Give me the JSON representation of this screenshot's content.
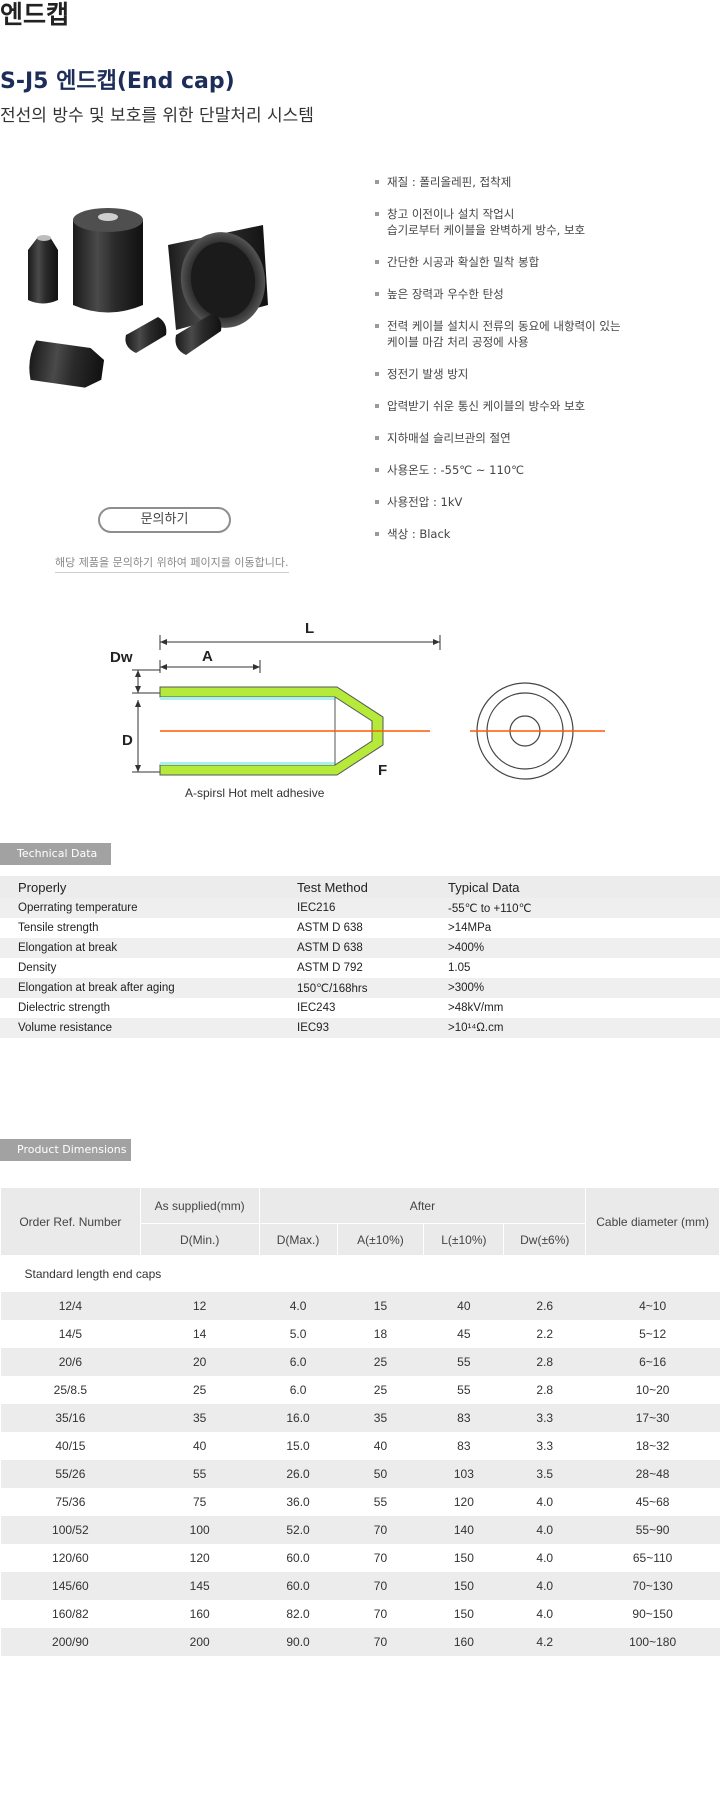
{
  "page_title": "엔드캡",
  "product": {
    "name": "S-J5 엔드캡(End cap)",
    "subtitle": "전선의 방수 및 보호를 위한 단말처리 시스템"
  },
  "inquiry": {
    "button_label": "문의하기",
    "note": "해당 제품을 문의하기 위하여 페이지를 이동합니다."
  },
  "features": [
    {
      "line1": "재질 : 폴리올레핀, 접착제",
      "line2": ""
    },
    {
      "line1": "창고 이전이나 설치 작업시",
      "line2": "습기로부터 케이블을 완벽하게 방수, 보호"
    },
    {
      "line1": "간단한 시공과 확실한 밀착 봉합",
      "line2": ""
    },
    {
      "line1": "높은 장력과 우수한 탄성",
      "line2": ""
    },
    {
      "line1": "전력 케이블 설치시 전류의 동요에 내항력이 있는",
      "line2": "케이블 마감 처리 공정에 사용"
    },
    {
      "line1": "정전기 발생 방지",
      "line2": ""
    },
    {
      "line1": "압력받기 쉬운 통신 케이블의 방수와 보호",
      "line2": ""
    },
    {
      "line1": "지하매설 슬리브관의 절연",
      "line2": ""
    },
    {
      "line1": "사용온도 : -55℃ ~ 110℃",
      "line2": ""
    },
    {
      "line1": "사용전압 : 1kV",
      "line2": ""
    },
    {
      "line1": "색상 : Black",
      "line2": ""
    }
  ],
  "diagram": {
    "label_L": "L",
    "label_A": "A",
    "label_Dw": "Dw",
    "label_D": "D",
    "label_F": "F",
    "caption": "A-spirsl Hot melt adhesive",
    "colors": {
      "wall": "#b5ea3a",
      "axis": "#ff5a00",
      "adhesive": "#a9f1f0"
    }
  },
  "technical": {
    "tab_label": "Technical Data",
    "headers": [
      "Properly",
      "Test Method",
      "Typical Data"
    ],
    "rows": [
      [
        "Operrating temperature",
        "IEC216",
        "-55℃ to +110℃"
      ],
      [
        "Tensile strength",
        "ASTM D 638",
        ">14MPa"
      ],
      [
        "Elongation at break",
        "ASTM D 638",
        ">400%"
      ],
      [
        "Density",
        "ASTM D 792",
        "1.05"
      ],
      [
        "Elongation at break after aging",
        "150℃/168hrs",
        ">300%"
      ],
      [
        "Dielectric strength",
        "IEC243",
        ">48kV/mm"
      ],
      [
        "Volume resistance",
        "IEC93",
        ">10¹⁴Ω.cm"
      ]
    ]
  },
  "dimensions": {
    "tab_label": "Product Dimensions",
    "header": {
      "order": "Order Ref. Number",
      "supplied": "As supplied(mm)",
      "after": "After",
      "cable": "Cable diameter (mm)",
      "sub": [
        "D(Min.)",
        "D(Max.)",
        "A(±10%)",
        "L(±10%)",
        "Dw(±6%)"
      ]
    },
    "group_label": "Standard length end caps",
    "rows": [
      [
        "12/4",
        "12",
        "4.0",
        "15",
        "40",
        "2.6",
        "4~10"
      ],
      [
        "14/5",
        "14",
        "5.0",
        "18",
        "45",
        "2.2",
        "5~12"
      ],
      [
        "20/6",
        "20",
        "6.0",
        "25",
        "55",
        "2.8",
        "6~16"
      ],
      [
        "25/8.5",
        "25",
        "6.0",
        "25",
        "55",
        "2.8",
        "10~20"
      ],
      [
        "35/16",
        "35",
        "16.0",
        "35",
        "83",
        "3.3",
        "17~30"
      ],
      [
        "40/15",
        "40",
        "15.0",
        "40",
        "83",
        "3.3",
        "18~32"
      ],
      [
        "55/26",
        "55",
        "26.0",
        "50",
        "103",
        "3.5",
        "28~48"
      ],
      [
        "75/36",
        "75",
        "36.0",
        "55",
        "120",
        "4.0",
        "45~68"
      ],
      [
        "100/52",
        "100",
        "52.0",
        "70",
        "140",
        "4.0",
        "55~90"
      ],
      [
        "120/60",
        "120",
        "60.0",
        "70",
        "150",
        "4.0",
        "65~110"
      ],
      [
        "145/60",
        "145",
        "60.0",
        "70",
        "150",
        "4.0",
        "70~130"
      ],
      [
        "160/82",
        "160",
        "82.0",
        "70",
        "150",
        "4.0",
        "90~150"
      ],
      [
        "200/90",
        "200",
        "90.0",
        "70",
        "160",
        "4.2",
        "100~180"
      ]
    ]
  }
}
